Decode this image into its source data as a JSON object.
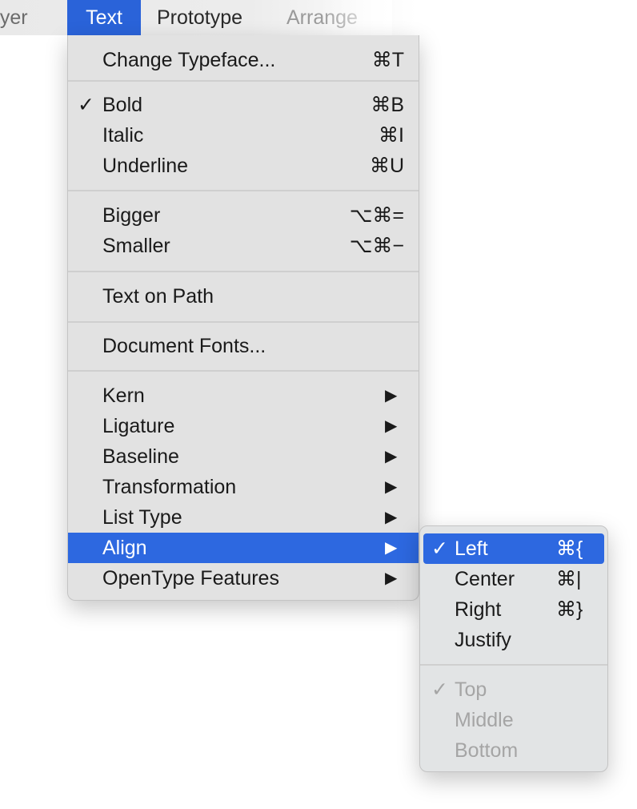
{
  "menubar": {
    "layer": "ayer",
    "text": "Text",
    "prototype": "Prototype",
    "arrange": "Arrange"
  },
  "menu": {
    "change_typeface": {
      "label": "Change Typeface...",
      "shortcut": "⌘T"
    },
    "bold": {
      "label": "Bold",
      "shortcut": "⌘B",
      "checked": true
    },
    "italic": {
      "label": "Italic",
      "shortcut": "⌘I"
    },
    "underline": {
      "label": "Underline",
      "shortcut": "⌘U"
    },
    "bigger": {
      "label": "Bigger",
      "shortcut": "⌥⌘="
    },
    "smaller": {
      "label": "Smaller",
      "shortcut": "⌥⌘−"
    },
    "text_on_path": {
      "label": "Text on Path"
    },
    "document_fonts": {
      "label": "Document Fonts..."
    },
    "kern": {
      "label": "Kern"
    },
    "ligature": {
      "label": "Ligature"
    },
    "baseline": {
      "label": "Baseline"
    },
    "transformation": {
      "label": "Transformation"
    },
    "list_type": {
      "label": "List Type"
    },
    "align": {
      "label": "Align",
      "highlighted": true
    },
    "opentype": {
      "label": "OpenType Features"
    }
  },
  "submenu": {
    "left": {
      "label": "Left",
      "shortcut": "⌘{",
      "checked": true
    },
    "center": {
      "label": "Center",
      "shortcut": "⌘|"
    },
    "right": {
      "label": "Right",
      "shortcut": "⌘}"
    },
    "justify": {
      "label": "Justify"
    },
    "top": {
      "label": "Top",
      "checked": true,
      "disabled": true
    },
    "middle": {
      "label": "Middle",
      "disabled": true
    },
    "bottom": {
      "label": "Bottom",
      "disabled": true
    }
  },
  "glyphs": {
    "check": "✓",
    "arrow": "▶"
  },
  "colors": {
    "highlight": "#2d68e0",
    "menu_bg": "#e2e2e2",
    "disabled": "#a5a5a5"
  }
}
